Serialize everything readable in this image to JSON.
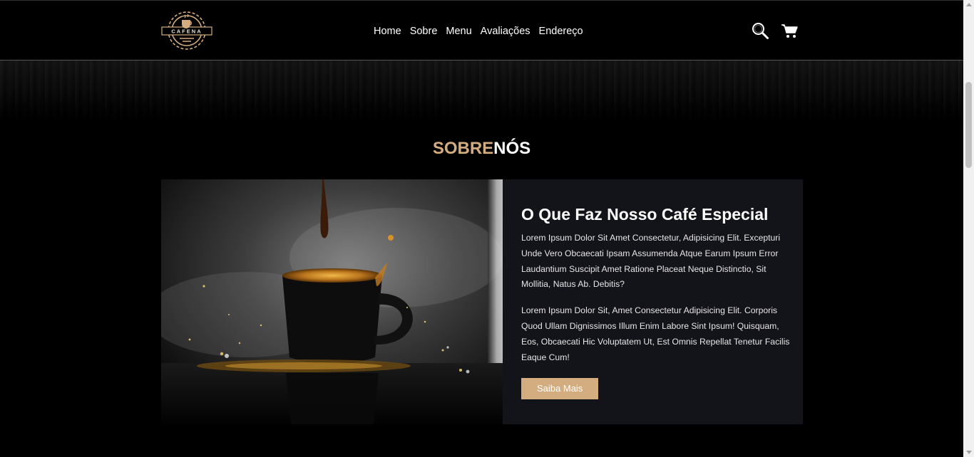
{
  "brand": {
    "logo_text": "CAFENA"
  },
  "nav": {
    "items": [
      "Home",
      "Sobre",
      "Menu",
      "Avaliações",
      "Endereço"
    ]
  },
  "header_icons": [
    "search-icon",
    "cart-icon"
  ],
  "section": {
    "title_accent": "SOBRE",
    "title_light": "NÓS"
  },
  "about": {
    "heading": "O Que Faz Nosso Café Especial",
    "paragraph_1": "Lorem Ipsum Dolor Sit Amet Consectetur, Adipisicing Elit. Excepturi Unde Vero Obcaecati Ipsam Assumenda Atque Earum Ipsum Error Laudantium Suscipit Amet Ratione Placeat Neque Distinctio, Sit Mollitia, Natus Ab. Debitis?",
    "paragraph_2": "Lorem Ipsum Dolor Sit, Amet Consectetur Adipisicing Elit. Corporis Quod Ullam Dignissimos Illum Enim Labore Sint Ipsum! Quisquam, Eos, Obcaecati Hic Voluptatem Ut, Est Omnis Repellat Tenetur Facilis Eaque Cum!",
    "button_label": "Saiba Mais"
  },
  "colors": {
    "accent": "#d3ad7f",
    "background": "#000000",
    "card_background": "#13131a"
  }
}
